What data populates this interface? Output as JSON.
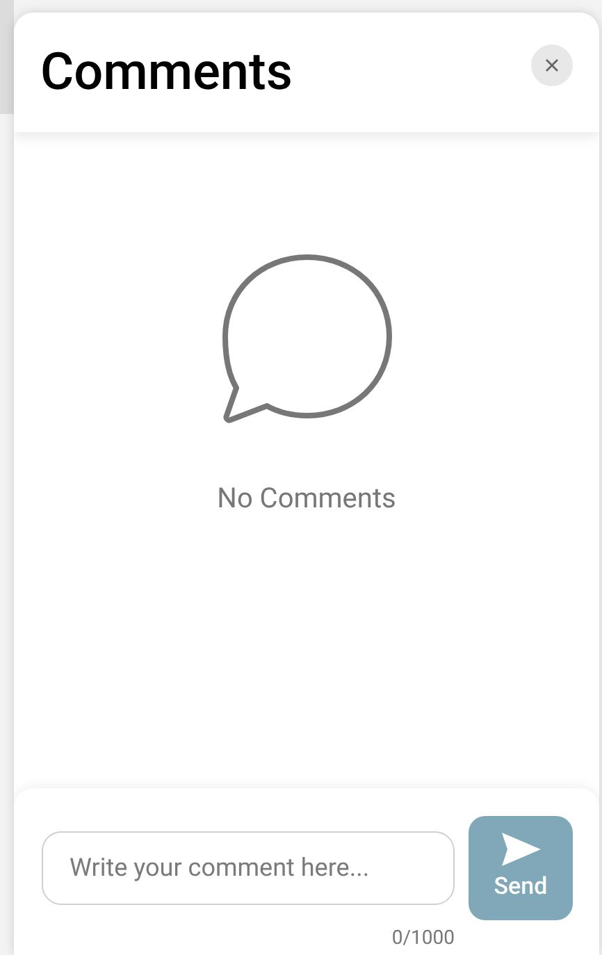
{
  "panel": {
    "title": "Comments"
  },
  "empty_state": {
    "message": "No Comments"
  },
  "composer": {
    "placeholder": "Write your comment here...",
    "counter": "0/1000",
    "send": {
      "label": "Send",
      "disabled": true
    }
  }
}
